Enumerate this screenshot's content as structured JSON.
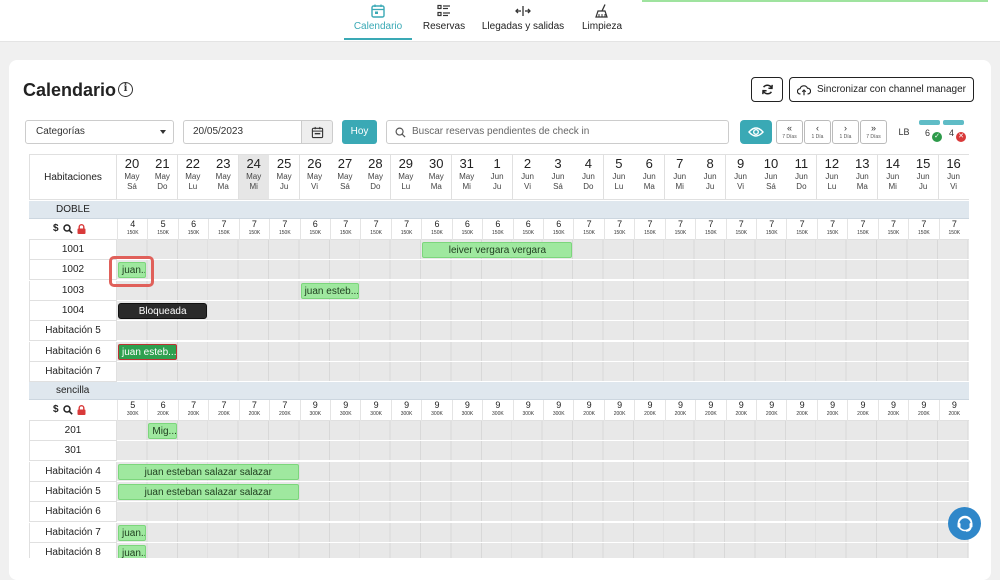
{
  "nav": {
    "tabs": [
      {
        "label": "Calendario",
        "active": true,
        "icon": "calendar-icon"
      },
      {
        "label": "Reservas",
        "active": false,
        "icon": "list-icon"
      },
      {
        "label": "Llegadas y salidas",
        "active": false,
        "icon": "arrows-icon"
      },
      {
        "label": "Limpieza",
        "active": false,
        "icon": "broom-icon"
      }
    ]
  },
  "header": {
    "title": "Calendario",
    "info": "i",
    "sync_label": "Sincronizar con channel manager"
  },
  "toolbar": {
    "category": "Categorías",
    "date": "20/05/2023",
    "today": "Hoy",
    "search_placeholder": "Buscar reservas pendientes de check in",
    "nav_buttons": [
      {
        "arrow": "«",
        "sub": "7 Días"
      },
      {
        "arrow": "‹",
        "sub": "1 Día"
      },
      {
        "arrow": "›",
        "sub": "1 Día"
      },
      {
        "arrow": "»",
        "sub": "7 Días"
      }
    ],
    "lb": "LB",
    "checked_in": "6",
    "checked_out": "4"
  },
  "calendar": {
    "rooms_header": "Habitaciones",
    "days": [
      {
        "d": "20",
        "m": "May",
        "w": "Sá"
      },
      {
        "d": "21",
        "m": "May",
        "w": "Do"
      },
      {
        "d": "22",
        "m": "May",
        "w": "Lu"
      },
      {
        "d": "23",
        "m": "May",
        "w": "Ma"
      },
      {
        "d": "24",
        "m": "May",
        "w": "Mi"
      },
      {
        "d": "25",
        "m": "May",
        "w": "Ju"
      },
      {
        "d": "26",
        "m": "May",
        "w": "Vi"
      },
      {
        "d": "27",
        "m": "May",
        "w": "Sá"
      },
      {
        "d": "28",
        "m": "May",
        "w": "Do"
      },
      {
        "d": "29",
        "m": "May",
        "w": "Lu"
      },
      {
        "d": "30",
        "m": "May",
        "w": "Ma"
      },
      {
        "d": "31",
        "m": "May",
        "w": "Mi"
      },
      {
        "d": "1",
        "m": "Jun",
        "w": "Ju"
      },
      {
        "d": "2",
        "m": "Jun",
        "w": "Vi"
      },
      {
        "d": "3",
        "m": "Jun",
        "w": "Sá"
      },
      {
        "d": "4",
        "m": "Jun",
        "w": "Do"
      },
      {
        "d": "5",
        "m": "Jun",
        "w": "Lu"
      },
      {
        "d": "6",
        "m": "Jun",
        "w": "Ma"
      },
      {
        "d": "7",
        "m": "Jun",
        "w": "Mi"
      },
      {
        "d": "8",
        "m": "Jun",
        "w": "Ju"
      },
      {
        "d": "9",
        "m": "Jun",
        "w": "Vi"
      },
      {
        "d": "10",
        "m": "Jun",
        "w": "Sá"
      },
      {
        "d": "11",
        "m": "Jun",
        "w": "Do"
      },
      {
        "d": "12",
        "m": "Jun",
        "w": "Lu"
      },
      {
        "d": "13",
        "m": "Jun",
        "w": "Ma"
      },
      {
        "d": "14",
        "m": "Jun",
        "w": "Mi"
      },
      {
        "d": "15",
        "m": "Jun",
        "w": "Ju"
      },
      {
        "d": "16",
        "m": "Jun",
        "w": "Vi"
      }
    ],
    "today_index": 4,
    "sections": [
      {
        "name": "DOBLE",
        "availability": [
          "4",
          "5",
          "6",
          "7",
          "7",
          "7",
          "6",
          "7",
          "7",
          "7",
          "6",
          "6",
          "6",
          "6",
          "6",
          "7",
          "7",
          "7",
          "7",
          "7",
          "7",
          "7",
          "7",
          "7",
          "7",
          "7",
          "7",
          "7"
        ],
        "prices": [
          "150K",
          "150K",
          "150K",
          "150K",
          "150K",
          "150K",
          "150K",
          "150K",
          "150K",
          "150K",
          "150K",
          "150K",
          "150K",
          "150K",
          "150K",
          "150K",
          "150K",
          "150K",
          "150K",
          "150K",
          "150K",
          "150K",
          "150K",
          "150K",
          "150K",
          "150K",
          "150K",
          "150K"
        ],
        "rooms": [
          {
            "name": "1001",
            "reservations": [
              {
                "label": "leiver vergara vergara",
                "start": 10,
                "span": 5,
                "style": "green",
                "center": true
              }
            ]
          },
          {
            "name": "1002",
            "reservations": [
              {
                "label": "juan...",
                "start": 0,
                "span": 1,
                "style": "green",
                "center": false
              }
            ]
          },
          {
            "name": "1003",
            "reservations": [
              {
                "label": "juan esteb...",
                "start": 6,
                "span": 2,
                "style": "green",
                "center": false
              }
            ]
          },
          {
            "name": "1004",
            "reservations": [
              {
                "label": "Bloqueada",
                "start": 0,
                "span": 3,
                "style": "dark",
                "center": true
              }
            ]
          },
          {
            "name": "Habitación 5",
            "reservations": []
          },
          {
            "name": "Habitación 6",
            "reservations": [
              {
                "label": "juan esteb...",
                "start": 0,
                "span": 2,
                "style": "darkgreen",
                "center": false
              }
            ]
          },
          {
            "name": "Habitación 7",
            "reservations": []
          }
        ]
      },
      {
        "name": "sencilla",
        "availability": [
          "5",
          "6",
          "7",
          "7",
          "7",
          "7",
          "9",
          "9",
          "9",
          "9",
          "9",
          "9",
          "9",
          "9",
          "9",
          "9",
          "9",
          "9",
          "9",
          "9",
          "9",
          "9",
          "9",
          "9",
          "9",
          "9",
          "9",
          "9"
        ],
        "prices": [
          "300K",
          "200K",
          "200K",
          "200K",
          "200K",
          "200K",
          "300K",
          "300K",
          "300K",
          "300K",
          "300K",
          "300K",
          "300K",
          "300K",
          "300K",
          "200K",
          "200K",
          "200K",
          "200K",
          "200K",
          "200K",
          "200K",
          "200K",
          "200K",
          "200K",
          "200K",
          "200K",
          "200K"
        ],
        "rooms": [
          {
            "name": "201",
            "reservations": [
              {
                "label": "Mig...",
                "start": 1,
                "span": 1,
                "style": "green",
                "center": false
              }
            ]
          },
          {
            "name": "301",
            "reservations": []
          },
          {
            "name": "Habitación 4",
            "reservations": [
              {
                "label": "juan esteban salazar salazar",
                "start": 0,
                "span": 6,
                "style": "green",
                "center": true
              }
            ]
          },
          {
            "name": "Habitación 5",
            "reservations": [
              {
                "label": "juan esteban salazar salazar",
                "start": 0,
                "span": 6,
                "style": "green",
                "center": true
              }
            ]
          },
          {
            "name": "Habitación 6",
            "reservations": []
          },
          {
            "name": "Habitación 7",
            "reservations": [
              {
                "label": "juan...",
                "start": 0,
                "span": 1,
                "style": "green",
                "center": false
              }
            ]
          },
          {
            "name": "Habitación 8",
            "reservations": [
              {
                "label": "juan...",
                "start": 0,
                "span": 1,
                "style": "green",
                "center": false
              }
            ]
          }
        ]
      }
    ]
  }
}
